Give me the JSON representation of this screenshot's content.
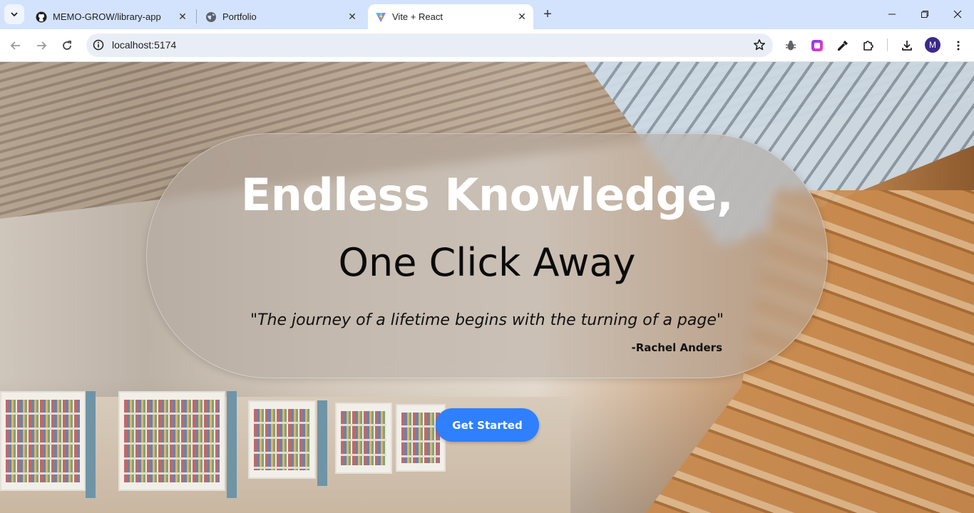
{
  "browser": {
    "tabs": [
      {
        "title": "MEMO-GROW/library-app",
        "icon": "github-icon",
        "active": false
      },
      {
        "title": "Portfolio",
        "icon": "globe-icon",
        "active": false
      },
      {
        "title": "Vite + React",
        "icon": "vite-icon",
        "active": true
      }
    ],
    "new_tab_symbol": "+",
    "url": "localhost:5174",
    "profile_initial": "M",
    "window_controls": [
      "minimize-icon",
      "restore-icon",
      "close-icon"
    ]
  },
  "hero": {
    "title": "Endless Knowledge,",
    "subtitle": "One Click Away",
    "quote": "\"The journey of a lifetime begins with the turning of a page\"",
    "author": "-Rachel Anders",
    "cta_label": "Get Started"
  },
  "colors": {
    "accent": "#2f80ff",
    "tabstrip": "#d3e3fd",
    "omnibox": "#e9eef6"
  }
}
